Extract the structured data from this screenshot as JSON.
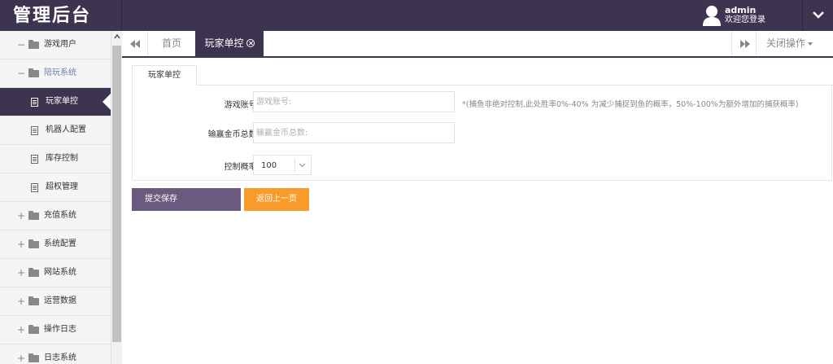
{
  "header": {
    "brand": "管理后台",
    "username": "admin",
    "welcome": "欢迎您登录"
  },
  "sidebar": {
    "items": [
      {
        "label": "游戏用户",
        "expander": "−"
      },
      {
        "label": "陪玩系统",
        "expander": "−"
      },
      {
        "label": "玩家单控"
      },
      {
        "label": "机器人配置"
      },
      {
        "label": "库存控制"
      },
      {
        "label": "超权管理"
      },
      {
        "label": "充值系统",
        "expander": "+"
      },
      {
        "label": "系统配置",
        "expander": "+"
      },
      {
        "label": "网站系统",
        "expander": "+"
      },
      {
        "label": "运营数据",
        "expander": "+"
      },
      {
        "label": "操作日志",
        "expander": "+"
      },
      {
        "label": "日志系统",
        "expander": "+"
      }
    ]
  },
  "tabs": {
    "home": "首页",
    "active": "玩家单控",
    "close_ops": "关闭操作"
  },
  "form": {
    "section_tab": "玩家单控",
    "account_label": "游戏账号:",
    "account_placeholder": "游戏账号:",
    "account_hint": "*(捕鱼非绝对控制,此处胜率0%-40% 为减少捕捉到鱼的概率，50%-100%为额外增加的捕获概率)",
    "coins_label": "输赢金币总数:",
    "coins_placeholder": "输赢金币总数:",
    "rate_label": "控制概率:",
    "rate_value": "100"
  },
  "buttons": {
    "submit": "提交保存",
    "back": "返回上一页"
  },
  "colors": {
    "header_bg": "#3d3550",
    "submit_bg": "#6a5a7f",
    "back_bg": "#f89b2a"
  }
}
